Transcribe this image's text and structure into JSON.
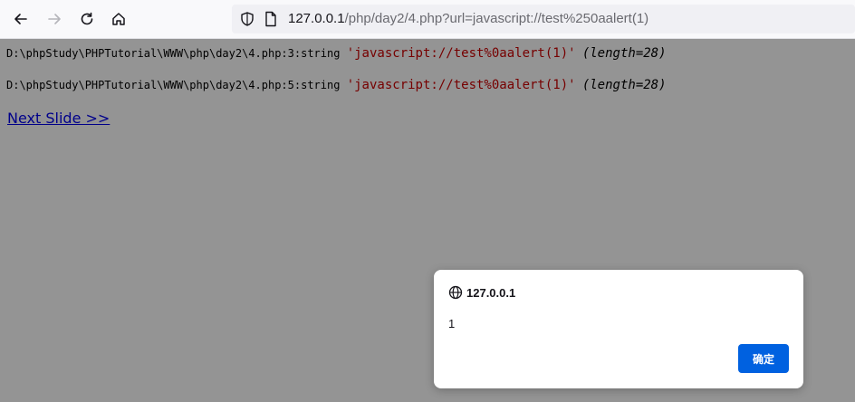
{
  "browser": {
    "url_host": "127.0.0.1",
    "url_rest": "/php/day2/4.php?url=javascript://test%250aalert(1)"
  },
  "page": {
    "dumps": [
      {
        "location": "D:\\phpStudy\\PHPTutorial\\WWW\\php\\day2\\4.php:3:",
        "type": "string",
        "value": "'javascript://test%0aalert(1)'",
        "length": "(length=28)"
      },
      {
        "location": "D:\\phpStudy\\PHPTutorial\\WWW\\php\\day2\\4.php:5:",
        "type": "string",
        "value": "'javascript://test%0aalert(1)'",
        "length": "(length=28)"
      }
    ],
    "next_link": "Next Slide >>"
  },
  "dialog": {
    "origin": "127.0.0.1",
    "message": "1",
    "ok_label": "确定"
  },
  "colors": {
    "accent": "#0061e0",
    "string_value": "#cc0000",
    "link": "#0000ee"
  },
  "icons": [
    "back-icon",
    "forward-icon",
    "reload-icon",
    "home-icon",
    "shield-icon",
    "page-icon",
    "globe-icon"
  ]
}
